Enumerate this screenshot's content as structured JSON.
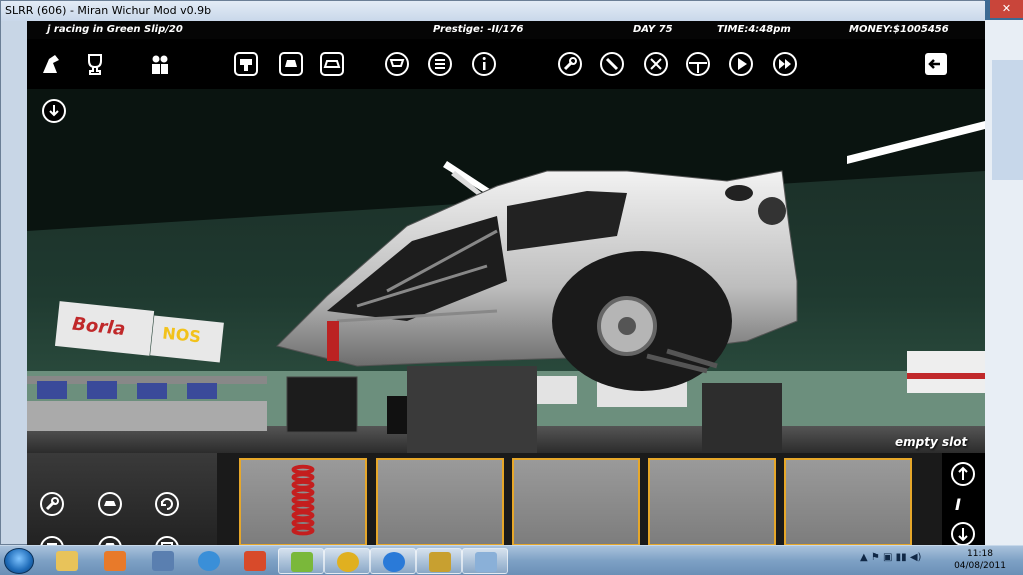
{
  "window": {
    "title": "SLRR (606) - Miran Wichur Mod v0.9b"
  },
  "hud": {
    "team": "j racing in Green Slip/20",
    "prestige": "Prestige: -II/176",
    "day": "DAY 75",
    "time": "TIME:4:48pm",
    "money": "MONEY:$1005456"
  },
  "menu_icons": [
    "dealer-horse-icon",
    "trophy-icon",
    "people-icon",
    "car-lift-icon",
    "car-front-icon",
    "car-swap-icon",
    "cart-icon",
    "list-icon",
    "info-icon",
    "wrench-icon",
    "screwdriver-icon",
    "tools-icon",
    "steering-wheel-icon",
    "play-icon",
    "fast-forward-icon",
    "exit-icon"
  ],
  "viewport": {
    "status_label": "empty slot"
  },
  "parts_panel": {
    "slot_index": "I",
    "slots": [
      {
        "filled": true,
        "part": "coil-spring-icon"
      },
      {
        "filled": false
      },
      {
        "filled": false
      },
      {
        "filled": false
      },
      {
        "filled": false
      }
    ]
  },
  "taskbar": {
    "items": [
      "explorer-icon",
      "media-player-icon",
      "control-panel-icon",
      "refresh-icon",
      "xampp-icon",
      "users-icon",
      "chrome-icon",
      "ie-icon",
      "slrr-game-icon",
      "paint-icon"
    ],
    "clock_time": "11:18",
    "clock_date": "04/08/2011"
  },
  "colors": {
    "accent": "#e6a72a",
    "hud_bg": "#000000",
    "taskbar": "#7ea1c5"
  }
}
